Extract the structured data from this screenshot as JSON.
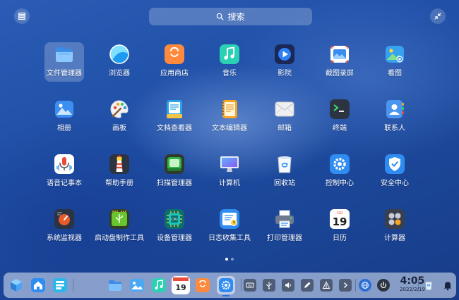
{
  "top": {
    "mode_icon": "list-view-icon",
    "exit_icon": "collapse-icon",
    "search_placeholder": "搜索"
  },
  "apps": [
    {
      "label": "文件管理器",
      "icon": "folder-icon",
      "color": "#5aa6f5",
      "selected": true
    },
    {
      "label": "浏览器",
      "icon": "browser-icon",
      "color": "#1e9bf0"
    },
    {
      "label": "应用商店",
      "icon": "store-bag-icon",
      "color": "#ff8a3d"
    },
    {
      "label": "音乐",
      "icon": "music-note-icon",
      "color": "#2bd1b3"
    },
    {
      "label": "影院",
      "icon": "play-icon",
      "color": "#243a7a"
    },
    {
      "label": "截图录屏",
      "icon": "screenshot-icon",
      "color": "#e8eefb"
    },
    {
      "label": "看图",
      "icon": "image-viewer-icon",
      "color": "#38a2f2"
    },
    {
      "label": "相册",
      "icon": "photo-album-icon",
      "color": "#3c8ff0"
    },
    {
      "label": "画板",
      "icon": "palette-icon",
      "color": "#f2f2f2"
    },
    {
      "label": "文档查看器",
      "icon": "document-viewer-icon",
      "color": "#27a5e8"
    },
    {
      "label": "文本编辑器",
      "icon": "notebook-icon",
      "color": "#f5a623"
    },
    {
      "label": "邮箱",
      "icon": "mail-envelope-icon",
      "color": "#f0f0f0"
    },
    {
      "label": "终端",
      "icon": "terminal-icon",
      "color": "#2b3440"
    },
    {
      "label": "联系人",
      "icon": "contacts-icon",
      "color": "#4a95ef"
    },
    {
      "label": "语音记事本",
      "icon": "voice-note-icon",
      "color": "#ffffff"
    },
    {
      "label": "帮助手册",
      "icon": "lighthouse-icon",
      "color": "#3a3f4d"
    },
    {
      "label": "扫描管理器",
      "icon": "scanner-icon",
      "color": "#33b24a"
    },
    {
      "label": "计算机",
      "icon": "computer-monitor-icon",
      "color": "#e6ecf5"
    },
    {
      "label": "回收站",
      "icon": "trash-icon",
      "color": "#f5f8fc"
    },
    {
      "label": "控制中心",
      "icon": "gear-icon",
      "color": "#2f8cf0"
    },
    {
      "label": "安全中心",
      "icon": "shield-icon",
      "color": "#2f8cf0"
    },
    {
      "label": "系统监视器",
      "icon": "system-monitor-icon",
      "color": "#3a3f4d"
    },
    {
      "label": "启动盘制作工具",
      "icon": "usb-drive-icon",
      "color": "#2f3d2a"
    },
    {
      "label": "设备管理器",
      "icon": "chip-icon",
      "color": "#18a7a0"
    },
    {
      "label": "日志收集工具",
      "icon": "log-collector-icon",
      "color": "#2f8cf0"
    },
    {
      "label": "打印管理器",
      "icon": "printer-icon",
      "color": "#6d7a90"
    },
    {
      "label": "日历",
      "icon": "calendar-icon",
      "color": "#ffffff",
      "day": "19",
      "month": "FEB"
    },
    {
      "label": "计算器",
      "icon": "calculator-icon",
      "color": "#3a3f4d"
    }
  ],
  "pagination": {
    "pages": 2,
    "current": 1
  },
  "dock": {
    "left": [
      {
        "name": "multitask-view-icon"
      },
      {
        "name": "home-icon"
      },
      {
        "name": "launcher-icon"
      }
    ],
    "apps": [
      {
        "name": "folder-icon",
        "active": false
      },
      {
        "name": "image-viewer-icon",
        "active": false
      },
      {
        "name": "music-note-icon",
        "active": false
      },
      {
        "name": "calendar-icon",
        "active": false,
        "day": "19"
      },
      {
        "name": "store-bag-icon",
        "active": false
      },
      {
        "name": "gear-icon",
        "active": true
      }
    ],
    "tray": [
      {
        "name": "keyboard-icon"
      },
      {
        "name": "usb-icon"
      },
      {
        "name": "volume-icon"
      },
      {
        "name": "pen-icon"
      },
      {
        "name": "network-icon"
      },
      {
        "name": "chevron-right-icon"
      }
    ],
    "extras": [
      {
        "name": "globe-icon"
      },
      {
        "name": "power-icon"
      }
    ],
    "clock": {
      "time": "4:05",
      "date": "2022/2/19"
    },
    "right": [
      {
        "name": "trash-icon"
      },
      {
        "name": "notification-bell-icon"
      }
    ]
  }
}
